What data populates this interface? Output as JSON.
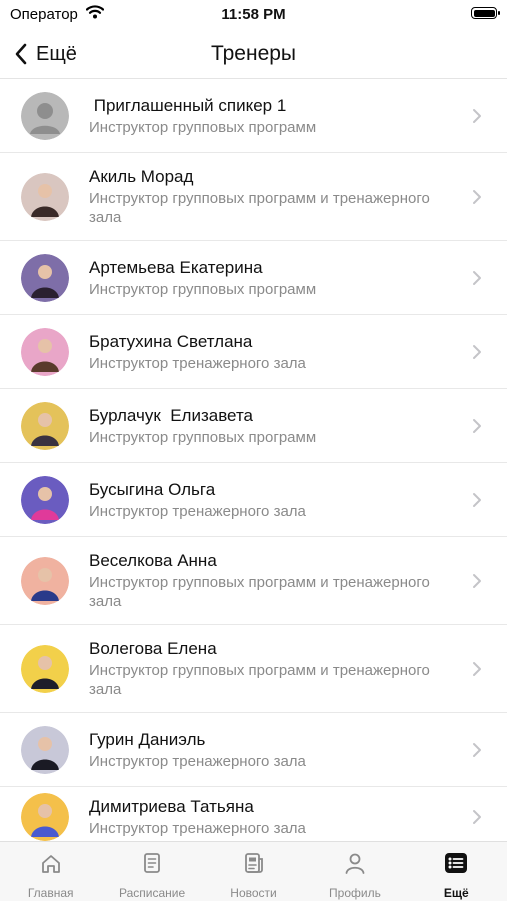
{
  "status_bar": {
    "carrier": "Оператор",
    "time": "11:58 PM"
  },
  "nav": {
    "back_label": "Ещё",
    "title": "Тренеры"
  },
  "trainers": [
    {
      "name": " Приглашенный спикер 1",
      "role": "Инструктор групповых программ",
      "avatar_colors": [
        "#b8b8b8",
        "#8e8e8e"
      ],
      "placeholder": true
    },
    {
      "name": "Акиль Морад",
      "role": "Инструктор групповых программ и тренажерного зала",
      "avatar_colors": [
        "#d9c6c0",
        "#3a2a28"
      ]
    },
    {
      "name": "Артемьева Екатерина",
      "role": "Инструктор групповых программ",
      "avatar_colors": [
        "#7e6ea8",
        "#2a2030"
      ]
    },
    {
      "name": "Братухина Светлана",
      "role": "Инструктор тренажерного зала",
      "avatar_colors": [
        "#e9a6c8",
        "#5a3a2c"
      ]
    },
    {
      "name": "Бурлачук  Елизавета",
      "role": "Инструктор групповых программ",
      "avatar_colors": [
        "#e4c25a",
        "#3a3240"
      ]
    },
    {
      "name": "Бусыгина Ольга",
      "role": "Инструктор тренажерного зала",
      "avatar_colors": [
        "#6a5cc0",
        "#e03a9a"
      ]
    },
    {
      "name": "Веселкова Анна",
      "role": "Инструктор групповых программ и тренажерного зала",
      "avatar_colors": [
        "#f0b2a0",
        "#2a3a8a"
      ]
    },
    {
      "name": "Волегова Елена",
      "role": "Инструктор групповых программ и тренажерного зала",
      "avatar_colors": [
        "#f2d04a",
        "#1e1e2a"
      ]
    },
    {
      "name": "Гурин Даниэль",
      "role": "Инструктор тренажерного зала",
      "avatar_colors": [
        "#c8c8d8",
        "#1a1a24"
      ]
    },
    {
      "name": "Димитриева Татьяна",
      "role": "Инструктор тренажерного зала",
      "avatar_colors": [
        "#f4c04a",
        "#4a5ad0"
      ]
    }
  ],
  "tabs": [
    {
      "label": "Главная",
      "icon": "home-icon",
      "active": false
    },
    {
      "label": "Расписание",
      "icon": "schedule-icon",
      "active": false
    },
    {
      "label": "Новости",
      "icon": "news-icon",
      "active": false
    },
    {
      "label": "Профиль",
      "icon": "profile-icon",
      "active": false
    },
    {
      "label": "Ещё",
      "icon": "more-list-icon",
      "active": true
    }
  ]
}
